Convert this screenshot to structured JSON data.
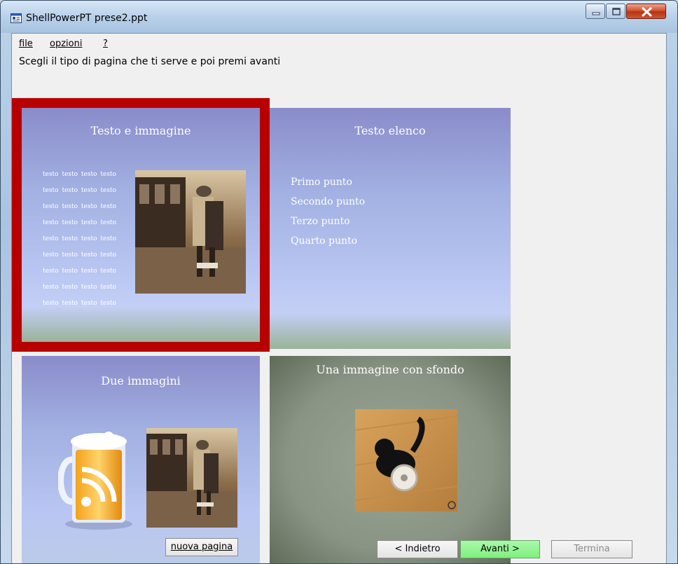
{
  "window": {
    "title": "ShellPowerPT prese2.ppt",
    "controls": [
      "minimize",
      "maximize",
      "close"
    ]
  },
  "menu": {
    "items": [
      {
        "label": "file"
      },
      {
        "label": "opzioni"
      },
      {
        "label": "?"
      }
    ]
  },
  "instruction": "Scegli il tipo di pagina che ti serve e poi premi avanti",
  "templates": [
    {
      "title": "Testo e immagine",
      "selected": true,
      "text_lines": [
        "testo  testo testo testo",
        "testo testo testo  testo",
        "testo  testo   testo testo",
        "testo  testo testo testo",
        "testo  testo testo testo",
        "testo  testo testo testo",
        "testo  testo testo testo",
        "testo  testo testo testo",
        "testo  testo testo testo"
      ]
    },
    {
      "title": "Testo elenco",
      "selected": false,
      "bullets": [
        "Primo punto",
        "Secondo punto",
        "Terzo punto",
        "Quarto punto"
      ]
    },
    {
      "title": "Due immagini",
      "selected": false
    },
    {
      "title": "Una immagine con sfondo",
      "selected": false
    }
  ],
  "buttons": {
    "new_page": "nuova pagina",
    "back": "< Indietro",
    "next": "Avanti >",
    "finish": "Termina"
  },
  "colors": {
    "selection": "#b80000",
    "next_button": "#8ff08f"
  }
}
